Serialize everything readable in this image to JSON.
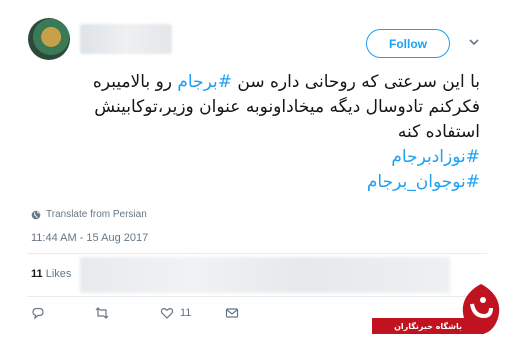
{
  "header": {
    "follow_label": "Follow",
    "avatar_icon": "user-avatar",
    "caret_icon": "chevron-down-icon"
  },
  "tweet": {
    "lines": [
      {
        "hashtag": "",
        "text": ""
      },
      {
        "text": "فکرکنم تادوسال دیگه میخاداونوبه عنوان وزیر،توکابینش"
      },
      {
        "text": "استفاده کنه"
      }
    ],
    "line1_before": "با این سرعتی که روحانی داره سن ",
    "line1_hashtag": "#برجام",
    "line1_after": " رو بالامیبره",
    "hashtag2": "#نوزادبرجام",
    "hashtag3": "#نوجوان_برجام"
  },
  "translate_label": "Translate from Persian",
  "timestamp": "11:44 AM - 15 Aug 2017",
  "likes": {
    "count": "11",
    "label": "Likes"
  },
  "actions": {
    "reply_icon": "reply-icon",
    "retweet_icon": "retweet-icon",
    "like_icon": "heart-icon",
    "like_count": "11",
    "dm_icon": "envelope-icon"
  },
  "watermark": {
    "text": "باشگاه خبرنگاران"
  },
  "colors": {
    "accent": "#1da1f2",
    "muted": "#657786",
    "watermark_red": "#c1121f"
  }
}
